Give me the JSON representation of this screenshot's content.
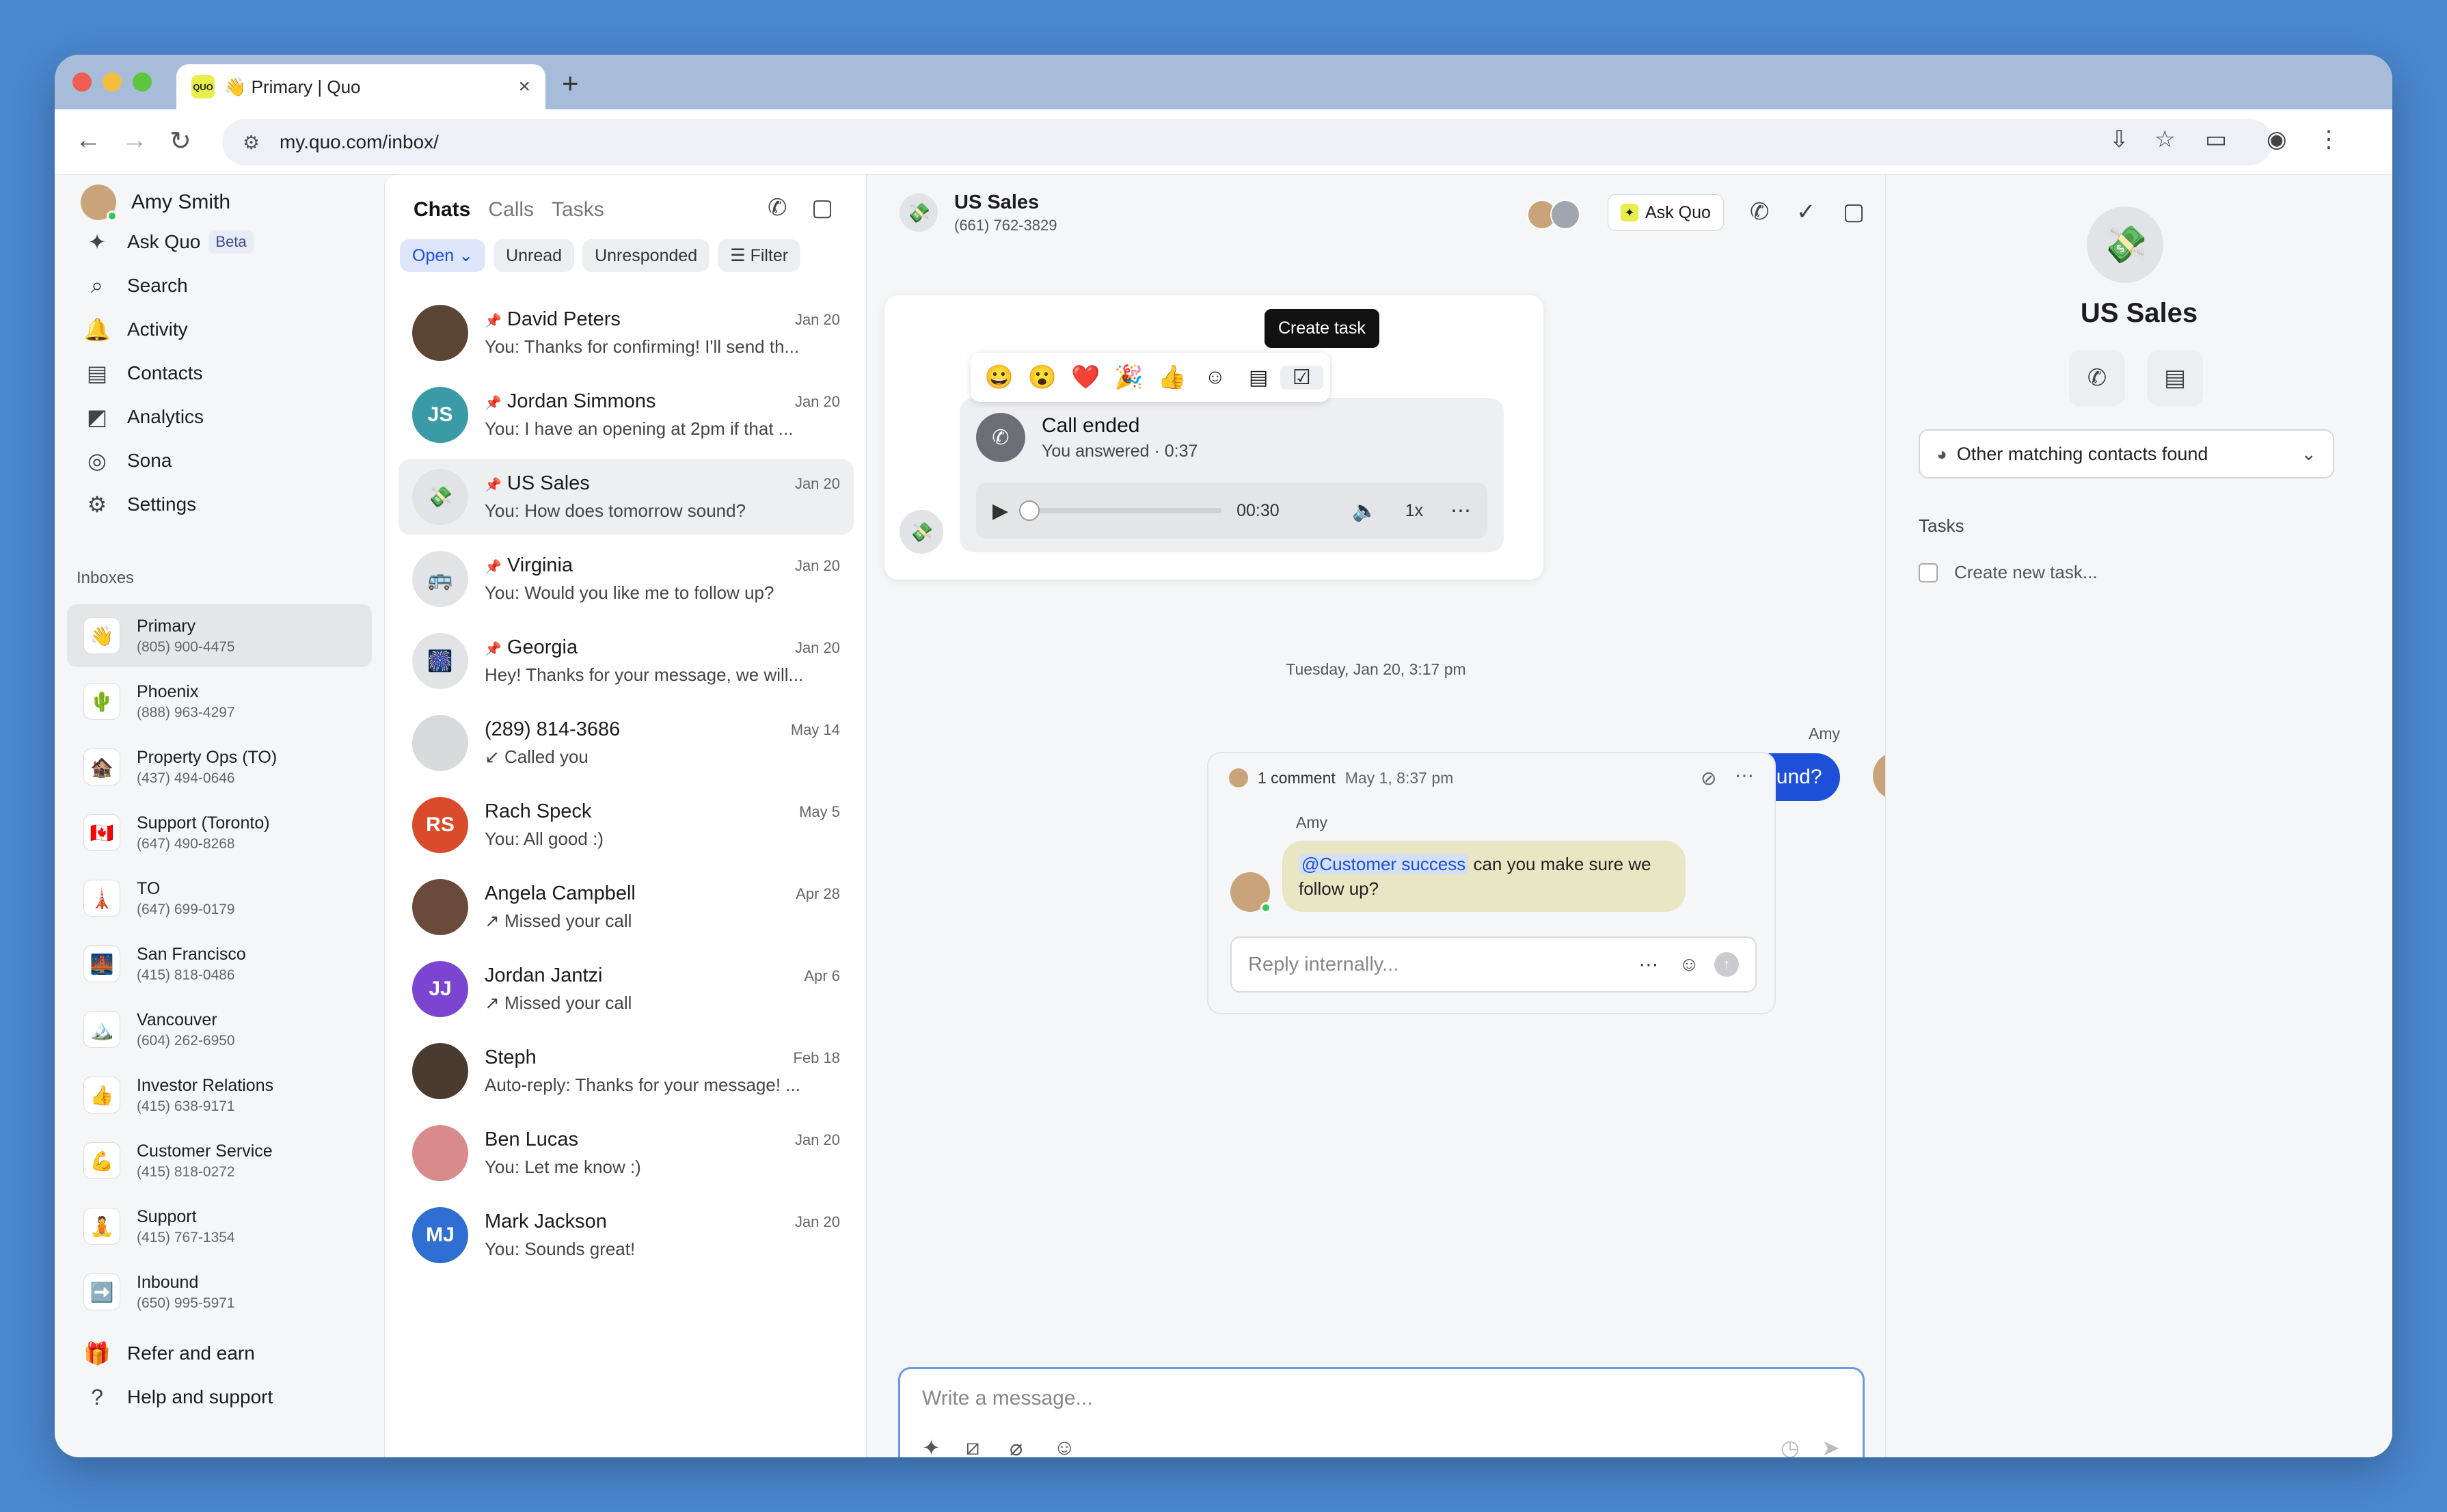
{
  "browser": {
    "tab_title": "👋 Primary | Quo",
    "favicon_text": "QUO",
    "url": "my.quo.com/inbox/"
  },
  "sidebar": {
    "user_name": "Amy Smith",
    "nav": [
      {
        "label": "Ask Quo",
        "badge": "Beta",
        "icon": "sparkles-icon"
      },
      {
        "label": "Search",
        "icon": "search-icon"
      },
      {
        "label": "Activity",
        "icon": "bell-icon"
      },
      {
        "label": "Contacts",
        "icon": "contacts-icon"
      },
      {
        "label": "Analytics",
        "icon": "analytics-icon"
      },
      {
        "label": "Sona",
        "icon": "sona-icon"
      },
      {
        "label": "Settings",
        "icon": "gear-icon"
      }
    ],
    "inboxes_heading": "Inboxes",
    "inboxes": [
      {
        "name": "Primary",
        "phone": "(805) 900-4475",
        "emoji": "👋"
      },
      {
        "name": "Phoenix",
        "phone": "(888) 963-4297",
        "emoji": "🌵"
      },
      {
        "name": "Property Ops (TO)",
        "phone": "(437) 494-0646",
        "emoji": "🏚️"
      },
      {
        "name": "Support (Toronto)",
        "phone": "(647) 490-8268",
        "emoji": "🇨🇦"
      },
      {
        "name": "TO",
        "phone": "(647) 699-0179",
        "emoji": "🗼"
      },
      {
        "name": "San Francisco",
        "phone": "(415) 818-0486",
        "emoji": "🌉"
      },
      {
        "name": "Vancouver",
        "phone": "(604) 262-6950",
        "emoji": "🏔️"
      },
      {
        "name": "Investor Relations",
        "phone": "(415) 638-9171",
        "emoji": "👍"
      },
      {
        "name": "Customer Service",
        "phone": "(415) 818-0272",
        "emoji": "💪"
      },
      {
        "name": "Support",
        "phone": "(415) 767-1354",
        "emoji": "🧘"
      },
      {
        "name": "Inbound",
        "phone": "(650) 995-5971",
        "emoji": "➡️"
      }
    ],
    "footer": [
      {
        "label": "Refer and earn",
        "icon": "gift-icon"
      },
      {
        "label": "Help and support",
        "icon": "help-icon"
      }
    ]
  },
  "conversations": {
    "tabs": [
      "Chats",
      "Calls",
      "Tasks"
    ],
    "filters": {
      "open": "Open",
      "unread": "Unread",
      "unresponded": "Unresponded",
      "filter": "Filter"
    },
    "items": [
      {
        "name": "David Peters",
        "date": "Jan 20",
        "preview": "You: Thanks for confirming! I'll send th...",
        "pinned": true,
        "initials": "",
        "color": "#5b4636"
      },
      {
        "name": "Jordan Simmons",
        "date": "Jan 20",
        "preview": "You: I have an opening at 2pm if that ...",
        "pinned": true,
        "initials": "JS",
        "color": "#3a9aa5"
      },
      {
        "name": "US Sales",
        "date": "Jan 20",
        "preview": "You: How does tomorrow sound?",
        "pinned": true,
        "initials": "💸",
        "color": "#e2e3e6"
      },
      {
        "name": "Virginia",
        "date": "Jan 20",
        "preview": "You: Would you like me to follow up?",
        "pinned": true,
        "initials": "🚌",
        "color": "#e2e3e6"
      },
      {
        "name": "Georgia",
        "date": "Jan 20",
        "preview": "Hey! Thanks for your message, we will...",
        "pinned": true,
        "initials": "🎆",
        "color": "#e2e3e6"
      },
      {
        "name": "(289) 814-3686",
        "date": "May 14",
        "preview": "↙ Called you",
        "pinned": false,
        "initials": "",
        "color": "#d8dadd"
      },
      {
        "name": "Rach Speck",
        "date": "May 5",
        "preview": "You: All good :)",
        "pinned": false,
        "initials": "RS",
        "color": "#d94b2b"
      },
      {
        "name": "Angela Campbell",
        "date": "Apr 28",
        "preview": "↗ Missed your call",
        "pinned": false,
        "initials": "",
        "color": "#6a4a3a"
      },
      {
        "name": "Jordan Jantzi",
        "date": "Apr 6",
        "preview": "↗ Missed your call",
        "pinned": false,
        "initials": "JJ",
        "color": "#7b45d1"
      },
      {
        "name": "Steph",
        "date": "Feb 18",
        "preview": "Auto-reply: Thanks for your message! ...",
        "pinned": false,
        "initials": "",
        "color": "#4a3b30"
      },
      {
        "name": "Ben Lucas",
        "date": "Jan 20",
        "preview": "You: Let me know :)",
        "pinned": false,
        "initials": "",
        "color": "#d98b8b"
      },
      {
        "name": "Mark Jackson",
        "date": "Jan 20",
        "preview": "You: Sounds great!",
        "pinned": false,
        "initials": "MJ",
        "color": "#2f6fd1"
      }
    ]
  },
  "chat": {
    "title": "US Sales",
    "phone": "(661) 762-3829",
    "ask_quo": "Ask Quo",
    "tooltip": "Create task",
    "reactions": [
      "😀",
      "😮",
      "❤️",
      "🎉",
      "👍"
    ],
    "call": {
      "title": "Call ended",
      "subtitle": "You answered · 0:37",
      "duration": "00:30",
      "speed": "1x",
      "progress": 0
    },
    "date_separator": "Tuesday, Jan 20, 3:17 pm",
    "sender": "Amy",
    "message": "How does tomorrow sound?",
    "thread": {
      "count": "1 comment",
      "date": "May 1, 8:37 pm",
      "author": "Amy",
      "mention": "@Customer success",
      "text": " can you make sure we follow up?",
      "reply_placeholder": "Reply internally..."
    },
    "composer_placeholder": "Write a message..."
  },
  "details": {
    "title": "US Sales",
    "emoji": "💸",
    "matching": "Other matching contacts found",
    "tasks_heading": "Tasks",
    "new_task": "Create new task..."
  },
  "colors": {
    "accent": "#1e4fd8",
    "background": "#4a87cf",
    "online": "#35c759"
  }
}
